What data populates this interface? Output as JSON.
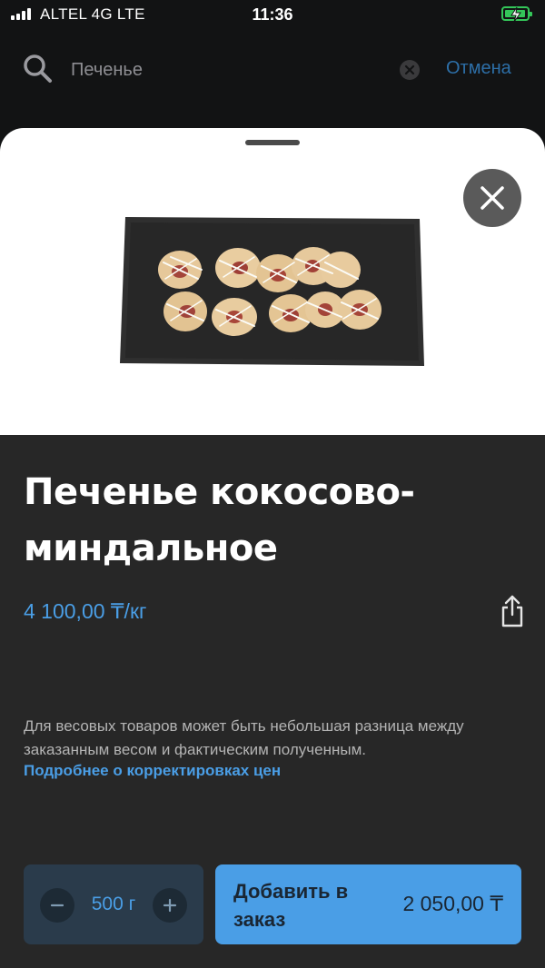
{
  "status_bar": {
    "carrier": "ALTEL 4G  LTE",
    "time": "11:36"
  },
  "search": {
    "query": "Печенье",
    "cancel_label": "Отмена"
  },
  "product": {
    "title": "Печенье кокосово-миндальное",
    "price": "4 100,00 ₸/кг",
    "note": "Для весовых товаров может быть небольшая разница между заказанным весом и фактическим полученным.",
    "note_link": "Подробнее о корректировках цен"
  },
  "order": {
    "quantity": "500 г",
    "add_label": "Добавить в заказ",
    "total": "2 050,00 ₸"
  },
  "colors": {
    "accent": "#4a9ee6",
    "sheet_background": "#272727",
    "battery": "#34c759"
  },
  "icons": [
    "search-icon",
    "clear-icon",
    "close-icon",
    "share-icon",
    "minus-icon",
    "plus-icon"
  ]
}
